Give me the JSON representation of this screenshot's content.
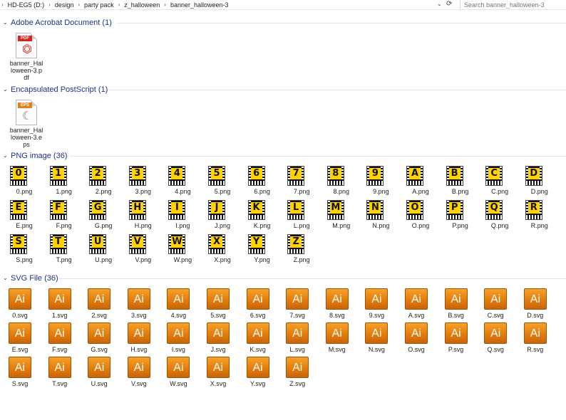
{
  "address": {
    "crumbs": [
      "HD-EG5 (D:)",
      "design",
      "party pack",
      "z_halloween",
      "banner_halloween-3"
    ],
    "separator": "›",
    "dropdown_icon": "chevron-down-icon",
    "refresh_icon": "refresh-icon"
  },
  "search": {
    "placeholder": "Search banner_halloween-3"
  },
  "groups": {
    "pdf": {
      "title": "Adobe Acrobat Document (1)",
      "files": [
        {
          "name": "banner_Halloween-3.pdf",
          "lines": [
            "banner_Hal",
            "loween-3.p",
            "df"
          ],
          "badge": "PDF",
          "color": "#d8251d"
        }
      ]
    },
    "eps": {
      "title": "Encapsulated PostScript (1)",
      "files": [
        {
          "name": "banner_Halloween-3.eps",
          "lines": [
            "banner_Hal",
            "loween-3.e",
            "ps"
          ],
          "badge": "EPS",
          "color": "#e0811a"
        }
      ]
    },
    "png": {
      "title": "PNG image (36)",
      "files": [
        "0.png",
        "1.png",
        "2.png",
        "3.png",
        "4.png",
        "5.png",
        "6.png",
        "7.png",
        "8.png",
        "9.png",
        "A.png",
        "B.png",
        "C.png",
        "D.png",
        "E.png",
        "F.png",
        "G.png",
        "H.png",
        "I.png",
        "J.png",
        "K.png",
        "L.png",
        "M.png",
        "N.png",
        "O.png",
        "P.png",
        "Q.png",
        "R.png",
        "S.png",
        "T.png",
        "U.png",
        "V.png",
        "W.png",
        "X.png",
        "Y.png",
        "Z.png"
      ],
      "letters": [
        "0",
        "1",
        "2",
        "3",
        "4",
        "5",
        "6",
        "7",
        "8",
        "9",
        "A",
        "B",
        "C",
        "D",
        "E",
        "F",
        "G",
        "H",
        "I",
        "J",
        "K",
        "L",
        "M",
        "N",
        "O",
        "P",
        "Q",
        "R",
        "S",
        "T",
        "U",
        "V",
        "W",
        "X",
        "Y",
        "Z"
      ]
    },
    "svg": {
      "title": "SVG File (36)",
      "icon_text": "Ai",
      "files": [
        "0.svg",
        "1.svg",
        "2.svg",
        "3.svg",
        "4.svg",
        "5.svg",
        "6.svg",
        "7.svg",
        "8.svg",
        "9.svg",
        "A.svg",
        "B.svg",
        "C.svg",
        "D.svg",
        "E.svg",
        "F.svg",
        "G.svg",
        "H.svg",
        "I.svg",
        "J.svg",
        "K.svg",
        "L.svg",
        "M.svg",
        "N.svg",
        "O.svg",
        "P.svg",
        "Q.svg",
        "R.svg",
        "S.svg",
        "T.svg",
        "U.svg",
        "V.svg",
        "W.svg",
        "X.svg",
        "Y.svg",
        "Z.svg"
      ]
    }
  },
  "colors": {
    "group_header": "#1e3287",
    "png_fill": "#ffd200",
    "ai_orange": "#e27a08"
  }
}
